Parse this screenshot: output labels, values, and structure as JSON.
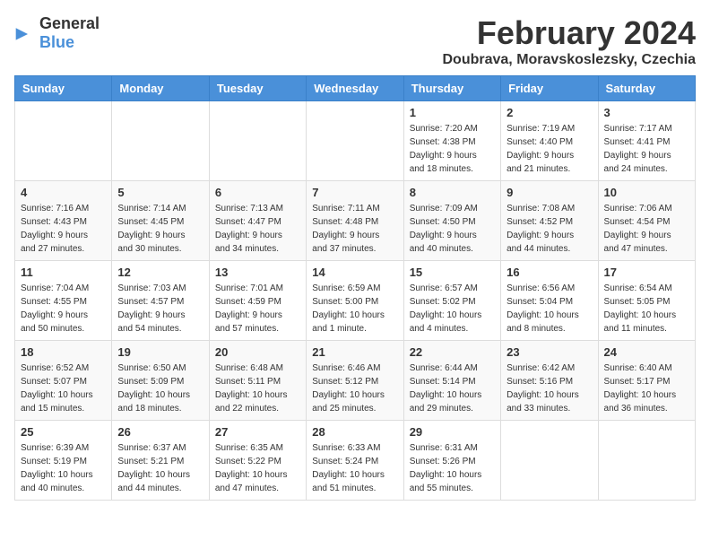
{
  "logo": {
    "general": "General",
    "blue": "Blue"
  },
  "header": {
    "month": "February 2024",
    "location": "Doubrava, Moravskoslezsky, Czechia"
  },
  "days_of_week": [
    "Sunday",
    "Monday",
    "Tuesday",
    "Wednesday",
    "Thursday",
    "Friday",
    "Saturday"
  ],
  "weeks": [
    [
      {
        "day": "",
        "info": ""
      },
      {
        "day": "",
        "info": ""
      },
      {
        "day": "",
        "info": ""
      },
      {
        "day": "",
        "info": ""
      },
      {
        "day": "1",
        "info": "Sunrise: 7:20 AM\nSunset: 4:38 PM\nDaylight: 9 hours\nand 18 minutes."
      },
      {
        "day": "2",
        "info": "Sunrise: 7:19 AM\nSunset: 4:40 PM\nDaylight: 9 hours\nand 21 minutes."
      },
      {
        "day": "3",
        "info": "Sunrise: 7:17 AM\nSunset: 4:41 PM\nDaylight: 9 hours\nand 24 minutes."
      }
    ],
    [
      {
        "day": "4",
        "info": "Sunrise: 7:16 AM\nSunset: 4:43 PM\nDaylight: 9 hours\nand 27 minutes."
      },
      {
        "day": "5",
        "info": "Sunrise: 7:14 AM\nSunset: 4:45 PM\nDaylight: 9 hours\nand 30 minutes."
      },
      {
        "day": "6",
        "info": "Sunrise: 7:13 AM\nSunset: 4:47 PM\nDaylight: 9 hours\nand 34 minutes."
      },
      {
        "day": "7",
        "info": "Sunrise: 7:11 AM\nSunset: 4:48 PM\nDaylight: 9 hours\nand 37 minutes."
      },
      {
        "day": "8",
        "info": "Sunrise: 7:09 AM\nSunset: 4:50 PM\nDaylight: 9 hours\nand 40 minutes."
      },
      {
        "day": "9",
        "info": "Sunrise: 7:08 AM\nSunset: 4:52 PM\nDaylight: 9 hours\nand 44 minutes."
      },
      {
        "day": "10",
        "info": "Sunrise: 7:06 AM\nSunset: 4:54 PM\nDaylight: 9 hours\nand 47 minutes."
      }
    ],
    [
      {
        "day": "11",
        "info": "Sunrise: 7:04 AM\nSunset: 4:55 PM\nDaylight: 9 hours\nand 50 minutes."
      },
      {
        "day": "12",
        "info": "Sunrise: 7:03 AM\nSunset: 4:57 PM\nDaylight: 9 hours\nand 54 minutes."
      },
      {
        "day": "13",
        "info": "Sunrise: 7:01 AM\nSunset: 4:59 PM\nDaylight: 9 hours\nand 57 minutes."
      },
      {
        "day": "14",
        "info": "Sunrise: 6:59 AM\nSunset: 5:00 PM\nDaylight: 10 hours\nand 1 minute."
      },
      {
        "day": "15",
        "info": "Sunrise: 6:57 AM\nSunset: 5:02 PM\nDaylight: 10 hours\nand 4 minutes."
      },
      {
        "day": "16",
        "info": "Sunrise: 6:56 AM\nSunset: 5:04 PM\nDaylight: 10 hours\nand 8 minutes."
      },
      {
        "day": "17",
        "info": "Sunrise: 6:54 AM\nSunset: 5:05 PM\nDaylight: 10 hours\nand 11 minutes."
      }
    ],
    [
      {
        "day": "18",
        "info": "Sunrise: 6:52 AM\nSunset: 5:07 PM\nDaylight: 10 hours\nand 15 minutes."
      },
      {
        "day": "19",
        "info": "Sunrise: 6:50 AM\nSunset: 5:09 PM\nDaylight: 10 hours\nand 18 minutes."
      },
      {
        "day": "20",
        "info": "Sunrise: 6:48 AM\nSunset: 5:11 PM\nDaylight: 10 hours\nand 22 minutes."
      },
      {
        "day": "21",
        "info": "Sunrise: 6:46 AM\nSunset: 5:12 PM\nDaylight: 10 hours\nand 25 minutes."
      },
      {
        "day": "22",
        "info": "Sunrise: 6:44 AM\nSunset: 5:14 PM\nDaylight: 10 hours\nand 29 minutes."
      },
      {
        "day": "23",
        "info": "Sunrise: 6:42 AM\nSunset: 5:16 PM\nDaylight: 10 hours\nand 33 minutes."
      },
      {
        "day": "24",
        "info": "Sunrise: 6:40 AM\nSunset: 5:17 PM\nDaylight: 10 hours\nand 36 minutes."
      }
    ],
    [
      {
        "day": "25",
        "info": "Sunrise: 6:39 AM\nSunset: 5:19 PM\nDaylight: 10 hours\nand 40 minutes."
      },
      {
        "day": "26",
        "info": "Sunrise: 6:37 AM\nSunset: 5:21 PM\nDaylight: 10 hours\nand 44 minutes."
      },
      {
        "day": "27",
        "info": "Sunrise: 6:35 AM\nSunset: 5:22 PM\nDaylight: 10 hours\nand 47 minutes."
      },
      {
        "day": "28",
        "info": "Sunrise: 6:33 AM\nSunset: 5:24 PM\nDaylight: 10 hours\nand 51 minutes."
      },
      {
        "day": "29",
        "info": "Sunrise: 6:31 AM\nSunset: 5:26 PM\nDaylight: 10 hours\nand 55 minutes."
      },
      {
        "day": "",
        "info": ""
      },
      {
        "day": "",
        "info": ""
      }
    ]
  ]
}
